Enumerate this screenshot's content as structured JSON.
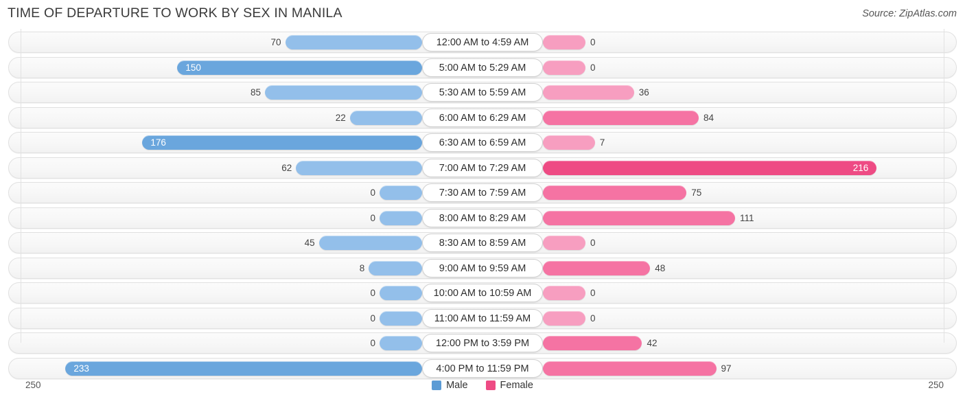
{
  "header": {
    "title": "TIME OF DEPARTURE TO WORK BY SEX IN MANILA",
    "source": "Source: ZipAtlas.com"
  },
  "axis": {
    "left_max_label": "250",
    "right_max_label": "250"
  },
  "legend": {
    "items": [
      {
        "label": "Male",
        "color": "#5b9bd5"
      },
      {
        "label": "Female",
        "color": "#ee4b84"
      }
    ]
  },
  "colors": {
    "male_light": "#93bfea",
    "male_strong": "#6aa6dd",
    "female_light": "#f79ec0",
    "female_mid": "#f573a3",
    "female_strong": "#ee4b84",
    "track": "#f7f7f7",
    "track_border": "#e0e0e0"
  },
  "chart_data": {
    "type": "bar",
    "title": "TIME OF DEPARTURE TO WORK BY SEX IN MANILA",
    "subtitle": "Source: ZipAtlas.com",
    "orientation": "horizontal-diverging",
    "xlabel": "",
    "ylabel": "",
    "xlim": [
      250,
      250
    ],
    "grid": false,
    "legend_position": "bottom-center",
    "categories": [
      "12:00 AM to 4:59 AM",
      "5:00 AM to 5:29 AM",
      "5:30 AM to 5:59 AM",
      "6:00 AM to 6:29 AM",
      "6:30 AM to 6:59 AM",
      "7:00 AM to 7:29 AM",
      "7:30 AM to 7:59 AM",
      "8:00 AM to 8:29 AM",
      "8:30 AM to 8:59 AM",
      "9:00 AM to 9:59 AM",
      "10:00 AM to 10:59 AM",
      "11:00 AM to 11:59 AM",
      "12:00 PM to 3:59 PM",
      "4:00 PM to 11:59 PM"
    ],
    "series": [
      {
        "name": "Male",
        "values": [
          70,
          150,
          85,
          22,
          176,
          62,
          0,
          0,
          45,
          8,
          0,
          0,
          0,
          233
        ]
      },
      {
        "name": "Female",
        "values": [
          0,
          0,
          36,
          84,
          7,
          216,
          75,
          111,
          0,
          48,
          0,
          0,
          42,
          97
        ]
      }
    ]
  },
  "rows": [
    {
      "label": "12:00 AM to 4:59 AM",
      "male": "70",
      "female": "0",
      "male_raw": 70,
      "female_raw": 0
    },
    {
      "label": "5:00 AM to 5:29 AM",
      "male": "150",
      "female": "0",
      "male_raw": 150,
      "female_raw": 0
    },
    {
      "label": "5:30 AM to 5:59 AM",
      "male": "85",
      "female": "36",
      "male_raw": 85,
      "female_raw": 36
    },
    {
      "label": "6:00 AM to 6:29 AM",
      "male": "22",
      "female": "84",
      "male_raw": 22,
      "female_raw": 84
    },
    {
      "label": "6:30 AM to 6:59 AM",
      "male": "176",
      "female": "7",
      "male_raw": 176,
      "female_raw": 7
    },
    {
      "label": "7:00 AM to 7:29 AM",
      "male": "62",
      "female": "216",
      "male_raw": 62,
      "female_raw": 216
    },
    {
      "label": "7:30 AM to 7:59 AM",
      "male": "0",
      "female": "75",
      "male_raw": 0,
      "female_raw": 75
    },
    {
      "label": "8:00 AM to 8:29 AM",
      "male": "0",
      "female": "111",
      "male_raw": 0,
      "female_raw": 111
    },
    {
      "label": "8:30 AM to 8:59 AM",
      "male": "45",
      "female": "0",
      "male_raw": 45,
      "female_raw": 0
    },
    {
      "label": "9:00 AM to 9:59 AM",
      "male": "8",
      "female": "48",
      "male_raw": 8,
      "female_raw": 48
    },
    {
      "label": "10:00 AM to 10:59 AM",
      "male": "0",
      "female": "0",
      "male_raw": 0,
      "female_raw": 0
    },
    {
      "label": "11:00 AM to 11:59 AM",
      "male": "0",
      "female": "0",
      "male_raw": 0,
      "female_raw": 0
    },
    {
      "label": "12:00 PM to 3:59 PM",
      "male": "0",
      "female": "42",
      "male_raw": 0,
      "female_raw": 42
    },
    {
      "label": "4:00 PM to 11:59 PM",
      "male": "233",
      "female": "97",
      "male_raw": 233,
      "female_raw": 97
    }
  ]
}
